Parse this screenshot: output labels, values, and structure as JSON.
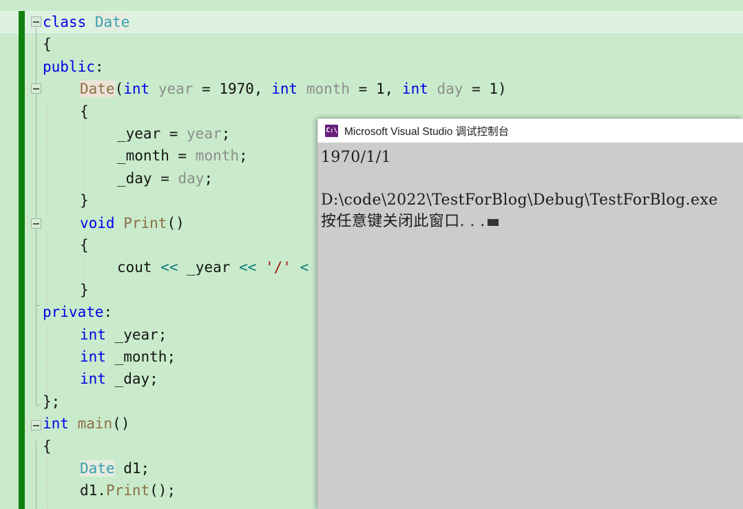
{
  "editor": {
    "name": "visual-studio-code-editor",
    "theme_background": "#c9ebcb",
    "change_bar_color": "#108010",
    "current_line_highlight": "#ddf2de",
    "lines": [
      {
        "n": 1,
        "indent": 0,
        "text": "class Date"
      },
      {
        "n": 2,
        "indent": 0,
        "text": "{"
      },
      {
        "n": 3,
        "indent": 0,
        "text": "public:"
      },
      {
        "n": 4,
        "indent": 1,
        "text": "Date(int year = 1970, int month = 1, int day = 1)"
      },
      {
        "n": 5,
        "indent": 1,
        "text": "{"
      },
      {
        "n": 6,
        "indent": 2,
        "text": "_year = year;"
      },
      {
        "n": 7,
        "indent": 2,
        "text": "_month = month;"
      },
      {
        "n": 8,
        "indent": 2,
        "text": "_day = day;"
      },
      {
        "n": 9,
        "indent": 1,
        "text": "}"
      },
      {
        "n": 10,
        "indent": 1,
        "text": "void Print()"
      },
      {
        "n": 11,
        "indent": 1,
        "text": "{"
      },
      {
        "n": 12,
        "indent": 2,
        "text": "cout << _year << '/'"
      },
      {
        "n": 13,
        "indent": 1,
        "text": "}"
      },
      {
        "n": 14,
        "indent": 0,
        "text": "private:"
      },
      {
        "n": 15,
        "indent": 1,
        "text": "int _year;"
      },
      {
        "n": 16,
        "indent": 1,
        "text": "int _month;"
      },
      {
        "n": 17,
        "indent": 1,
        "text": "int _day;"
      },
      {
        "n": 18,
        "indent": 0,
        "text": "};"
      },
      {
        "n": 19,
        "indent": 0,
        "text": "int main()"
      },
      {
        "n": 20,
        "indent": 0,
        "text": "{"
      },
      {
        "n": 21,
        "indent": 1,
        "text": "Date d1;"
      },
      {
        "n": 22,
        "indent": 1,
        "text": "d1.Print();"
      }
    ],
    "tokens": {
      "l1": [
        {
          "t": "class",
          "c": "t-kw"
        },
        {
          "t": " ",
          "c": "t-plain"
        },
        {
          "t": "Date",
          "c": "t-type-hl"
        }
      ],
      "l2": [
        {
          "t": "{",
          "c": "t-plain"
        }
      ],
      "l3": [
        {
          "t": "public",
          "c": "t-kw"
        },
        {
          "t": ":",
          "c": "t-plain"
        }
      ],
      "l4": [
        {
          "t": "Date",
          "c": "t-fn-hl"
        },
        {
          "t": "(",
          "c": "t-plain"
        },
        {
          "t": "int",
          "c": "t-kw"
        },
        {
          "t": " ",
          "c": "t-plain"
        },
        {
          "t": "year",
          "c": "t-param"
        },
        {
          "t": " = ",
          "c": "t-plain"
        },
        {
          "t": "1970",
          "c": "t-num"
        },
        {
          "t": ", ",
          "c": "t-plain"
        },
        {
          "t": "int",
          "c": "t-kw"
        },
        {
          "t": " ",
          "c": "t-plain"
        },
        {
          "t": "month",
          "c": "t-param"
        },
        {
          "t": " = ",
          "c": "t-plain"
        },
        {
          "t": "1",
          "c": "t-num"
        },
        {
          "t": ", ",
          "c": "t-plain"
        },
        {
          "t": "int",
          "c": "t-kw"
        },
        {
          "t": " ",
          "c": "t-plain"
        },
        {
          "t": "day",
          "c": "t-param"
        },
        {
          "t": " = ",
          "c": "t-plain"
        },
        {
          "t": "1",
          "c": "t-num"
        },
        {
          "t": ")",
          "c": "t-plain"
        }
      ],
      "l5": [
        {
          "t": "{",
          "c": "t-plain"
        }
      ],
      "l6": [
        {
          "t": "_year",
          "c": "t-plain"
        },
        {
          "t": " = ",
          "c": "t-plain"
        },
        {
          "t": "year",
          "c": "t-param"
        },
        {
          "t": ";",
          "c": "t-plain"
        }
      ],
      "l7": [
        {
          "t": "_month",
          "c": "t-plain"
        },
        {
          "t": " = ",
          "c": "t-plain"
        },
        {
          "t": "month",
          "c": "t-param"
        },
        {
          "t": ";",
          "c": "t-plain"
        }
      ],
      "l8": [
        {
          "t": "_day",
          "c": "t-plain"
        },
        {
          "t": " = ",
          "c": "t-plain"
        },
        {
          "t": "day",
          "c": "t-param"
        },
        {
          "t": ";",
          "c": "t-plain"
        }
      ],
      "l9": [
        {
          "t": "}",
          "c": "t-plain"
        }
      ],
      "l10": [
        {
          "t": "void",
          "c": "t-kw"
        },
        {
          "t": " ",
          "c": "t-plain"
        },
        {
          "t": "Print",
          "c": "t-fn"
        },
        {
          "t": "()",
          "c": "t-plain"
        }
      ],
      "l11": [
        {
          "t": "{",
          "c": "t-plain"
        }
      ],
      "l12": [
        {
          "t": "cout",
          "c": "t-plain"
        },
        {
          "t": " ",
          "c": "t-plain"
        },
        {
          "t": "<<",
          "c": "t-stream"
        },
        {
          "t": " ",
          "c": "t-plain"
        },
        {
          "t": "_year",
          "c": "t-plain"
        },
        {
          "t": " ",
          "c": "t-plain"
        },
        {
          "t": "<<",
          "c": "t-stream"
        },
        {
          "t": " ",
          "c": "t-plain"
        },
        {
          "t": "'/'",
          "c": "t-str"
        },
        {
          "t": " <",
          "c": "t-stream"
        }
      ],
      "l13": [
        {
          "t": "}",
          "c": "t-plain"
        }
      ],
      "l14": [
        {
          "t": "private",
          "c": "t-kw"
        },
        {
          "t": ":",
          "c": "t-plain"
        }
      ],
      "l15": [
        {
          "t": "int",
          "c": "t-kw"
        },
        {
          "t": " ",
          "c": "t-plain"
        },
        {
          "t": "_year;",
          "c": "t-plain"
        }
      ],
      "l16": [
        {
          "t": "int",
          "c": "t-kw"
        },
        {
          "t": " ",
          "c": "t-plain"
        },
        {
          "t": "_month;",
          "c": "t-plain"
        }
      ],
      "l17": [
        {
          "t": "int",
          "c": "t-kw"
        },
        {
          "t": " ",
          "c": "t-plain"
        },
        {
          "t": "_day;",
          "c": "t-plain"
        }
      ],
      "l18": [
        {
          "t": "};",
          "c": "t-plain"
        }
      ],
      "l19": [
        {
          "t": "int",
          "c": "t-kw"
        },
        {
          "t": " ",
          "c": "t-plain"
        },
        {
          "t": "main",
          "c": "t-fn"
        },
        {
          "t": "()",
          "c": "t-plain"
        }
      ],
      "l20": [
        {
          "t": "{",
          "c": "t-plain"
        }
      ],
      "l21": [
        {
          "t": "Date",
          "c": "t-type-hl"
        },
        {
          "t": " d1;",
          "c": "t-plain"
        }
      ],
      "l22": [
        {
          "t": "d1.",
          "c": "t-plain"
        },
        {
          "t": "Print",
          "c": "t-fn"
        },
        {
          "t": "();",
          "c": "t-plain"
        }
      ]
    },
    "fold_markers": [
      {
        "name": "fold-marker-class",
        "line": 1
      },
      {
        "name": "fold-marker-constructor",
        "line": 4
      },
      {
        "name": "fold-marker-print",
        "line": 10
      },
      {
        "name": "fold-marker-main",
        "line": 19
      }
    ]
  },
  "console": {
    "window_name": "debug-console-window",
    "icon": "console-app-icon",
    "icon_glyph": "C:\\",
    "title": "Microsoft Visual Studio 调试控制台",
    "background": "#cccccc",
    "titlebar_background": "#ffffff",
    "output_lines": [
      "1970/1/1",
      "",
      "D:\\code\\2022\\TestForBlog\\Debug\\TestForBlog.exe",
      "按任意键关闭此窗口. . ."
    ]
  }
}
